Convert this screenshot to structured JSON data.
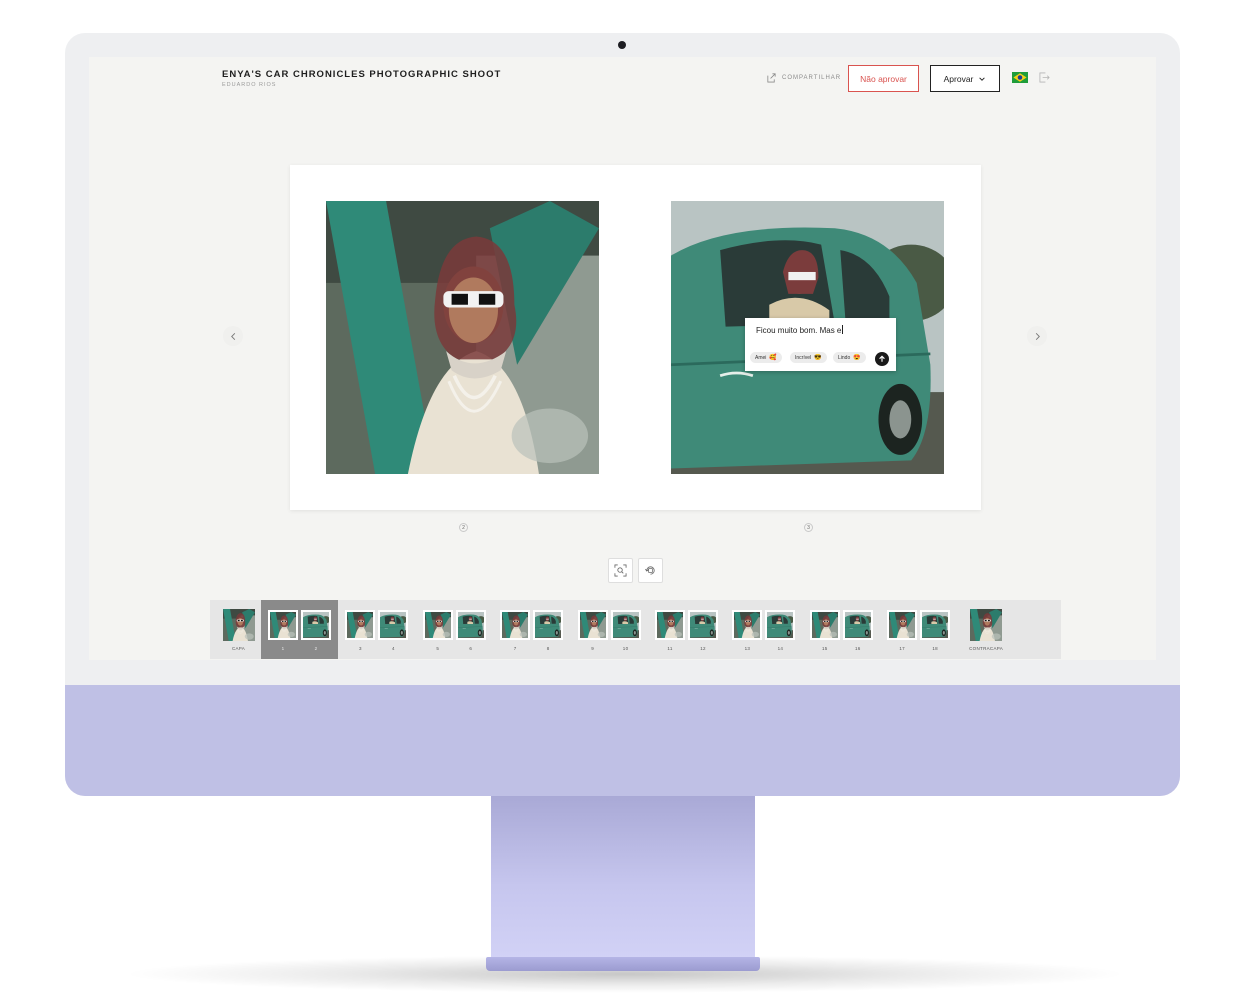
{
  "app": {
    "title": "ENYA'S CAR CHRONICLES PHOTOGRAPHIC SHOOT",
    "subtitle": "EDUARDO RIOS"
  },
  "toolbar": {
    "share_label": "COMPARTILHAR",
    "reject_label": "Não aprovar",
    "approve_label": "Aprovar",
    "language_flag": "brazil-flag",
    "logout_icon": "logout-icon"
  },
  "spread": {
    "left_page_number": "2",
    "right_page_number": "3"
  },
  "comment": {
    "text": "Ficou muito bom. Mas e",
    "reactions": [
      {
        "label": "Amei",
        "emoji": "🥰"
      },
      {
        "label": "Incrível",
        "emoji": "😎"
      },
      {
        "label": "Lindo",
        "emoji": "😍"
      }
    ]
  },
  "tools": {
    "zoom_icon": "zoom-icon",
    "rotate_icon": "rotate-icon"
  },
  "thumbnails": {
    "items": [
      {
        "labels": [
          "CAPA"
        ]
      },
      {
        "labels": [
          "1",
          "2"
        ],
        "active": true
      },
      {
        "labels": [
          "3",
          "4"
        ]
      },
      {
        "labels": [
          "5",
          "6"
        ]
      },
      {
        "labels": [
          "7",
          "8"
        ]
      },
      {
        "labels": [
          "9",
          "10"
        ]
      },
      {
        "labels": [
          "11",
          "12"
        ]
      },
      {
        "labels": [
          "13",
          "14"
        ]
      },
      {
        "labels": [
          "15",
          "16"
        ]
      },
      {
        "labels": [
          "17",
          "18"
        ]
      },
      {
        "labels": [
          "CONTRACAPA"
        ]
      }
    ]
  },
  "colors": {
    "reject": "#d9534f",
    "monitor_chin": "#bfc0e5",
    "active_thumb": "#8a8a8a"
  }
}
